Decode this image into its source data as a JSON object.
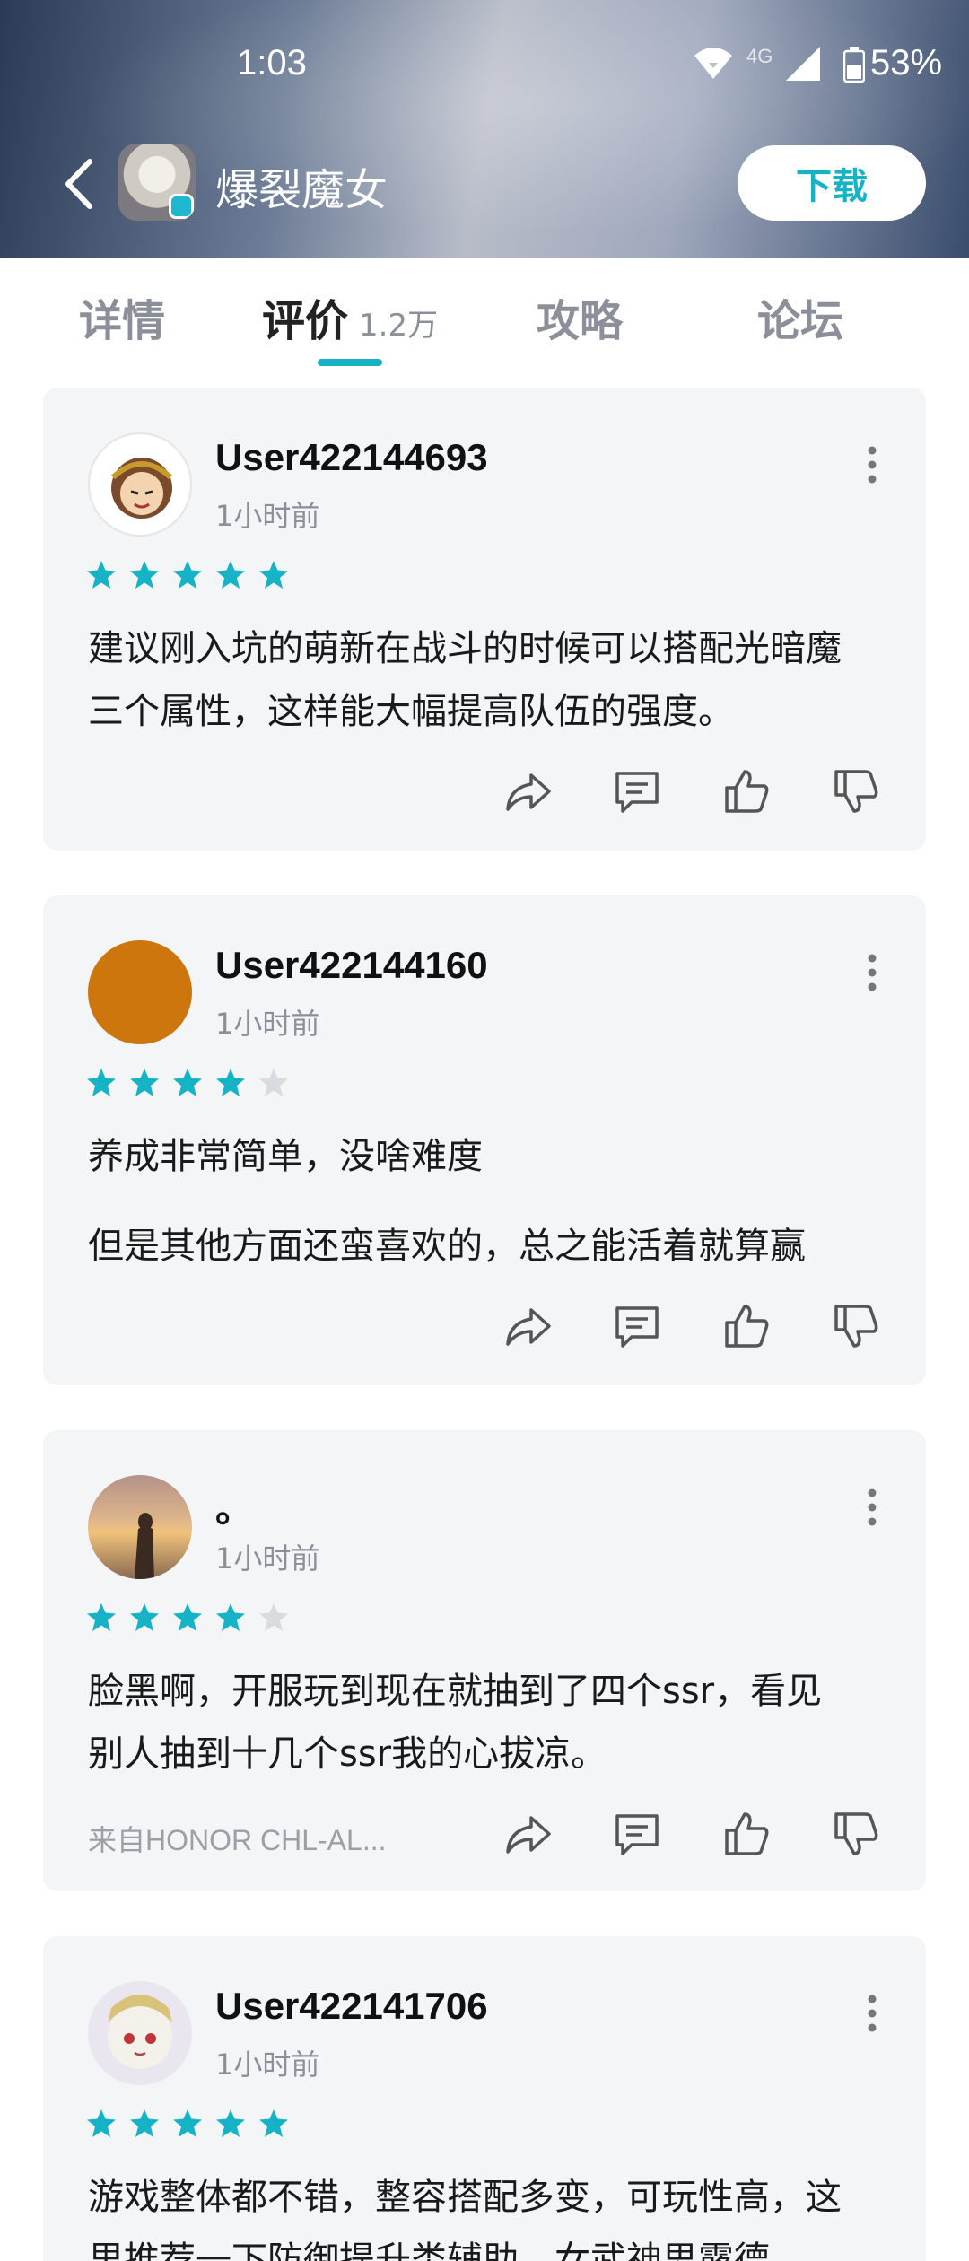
{
  "status_bar": {
    "time": "1:03",
    "network": "4G",
    "battery": "53%"
  },
  "header": {
    "title": "爆裂魔女",
    "download_label": "下载"
  },
  "tabs": [
    {
      "label": "详情"
    },
    {
      "label": "评价",
      "count": "1.2万"
    },
    {
      "label": "攻略"
    },
    {
      "label": "论坛"
    }
  ],
  "reviews": [
    {
      "user": "User422144693",
      "time": "1小时前",
      "rating": 5,
      "lines": [
        "建议刚入坑的萌新在战斗的时候可以搭配光暗魔",
        "三个属性，这样能大幅提高队伍的强度。"
      ]
    },
    {
      "user": "User422144160",
      "time": "1小时前",
      "rating": 4,
      "lines": [
        "养成非常简单，没啥难度",
        "但是其他方面还蛮喜欢的，总之能活着就算赢"
      ]
    },
    {
      "user": "。",
      "time": "1小时前",
      "rating": 4,
      "lines": [
        "脸黑啊，开服玩到现在就抽到了四个ssr，看见",
        "别人抽到十几个ssr我的心拔凉。"
      ],
      "device": "来自HONOR CHL-AL..."
    },
    {
      "user": "User422141706",
      "time": "1小时前",
      "rating": 5,
      "lines": [
        "游戏整体都不错，整容搭配多变，可玩性高，这",
        "里推荐一下防御提升类辅助，女武神思露德"
      ]
    }
  ],
  "colors": {
    "accent": "#16b3c7",
    "star_off": "#d9dbe0",
    "card_bg": "#f4f5f7"
  }
}
